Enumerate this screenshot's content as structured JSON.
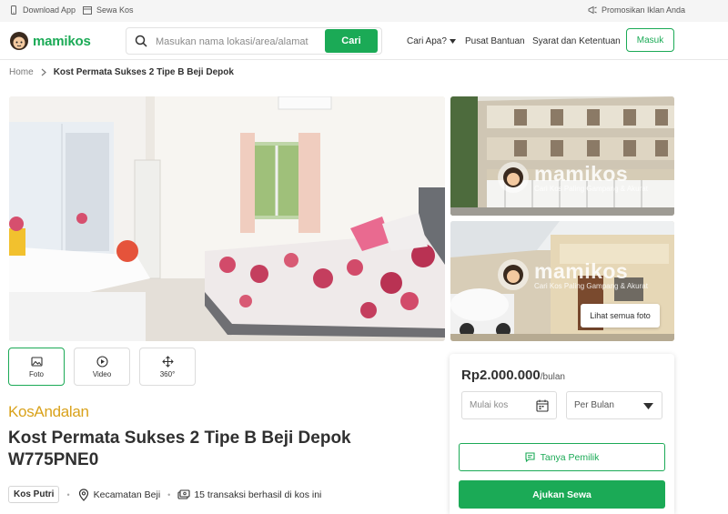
{
  "topbar": {
    "download_app": "Download App",
    "sewa_kos": "Sewa Kos",
    "promosikan": "Promosikan Iklan Anda"
  },
  "navbar": {
    "logo_text": "mamikos",
    "search_placeholder": "Masukan nama lokasi/area/alamat",
    "search_button": "Cari",
    "cari_apa": "Cari Apa?",
    "pusat_bantuan": "Pusat Bantuan",
    "syarat": "Syarat dan Ketentuan",
    "masuk": "Masuk"
  },
  "breadcrumb": {
    "home": "Home",
    "current": "Kost Permata Sukses 2 Tipe B Beji Depok"
  },
  "gallery": {
    "watermark_name": "mamikos",
    "watermark_tagline": "Cari Kos Paling Gampang & Akurat",
    "see_all": "Lihat semua foto",
    "media_buttons": [
      {
        "label": "Foto",
        "icon": "image-icon"
      },
      {
        "label": "Video",
        "icon": "play-icon"
      },
      {
        "label": "360°",
        "icon": "move-icon"
      }
    ]
  },
  "listing": {
    "badge_kos": "Kos",
    "badge_andalan": "Andalan",
    "title": "Kost Permata Sukses 2 Tipe B Beji Depok W775PNE0",
    "gender_tag": "Kos Putri",
    "location": "Kecamatan Beji",
    "transactions": "15 transaksi berhasil di kos ini"
  },
  "booking": {
    "price": "Rp2.000.000",
    "period": "/bulan",
    "start_placeholder": "Mulai kos",
    "duration": "Per Bulan",
    "ask_owner": "Tanya Pemilik",
    "apply": "Ajukan Sewa"
  },
  "colors": {
    "brand_green": "#1baa56",
    "andalan_gold": "#d9a21b"
  }
}
